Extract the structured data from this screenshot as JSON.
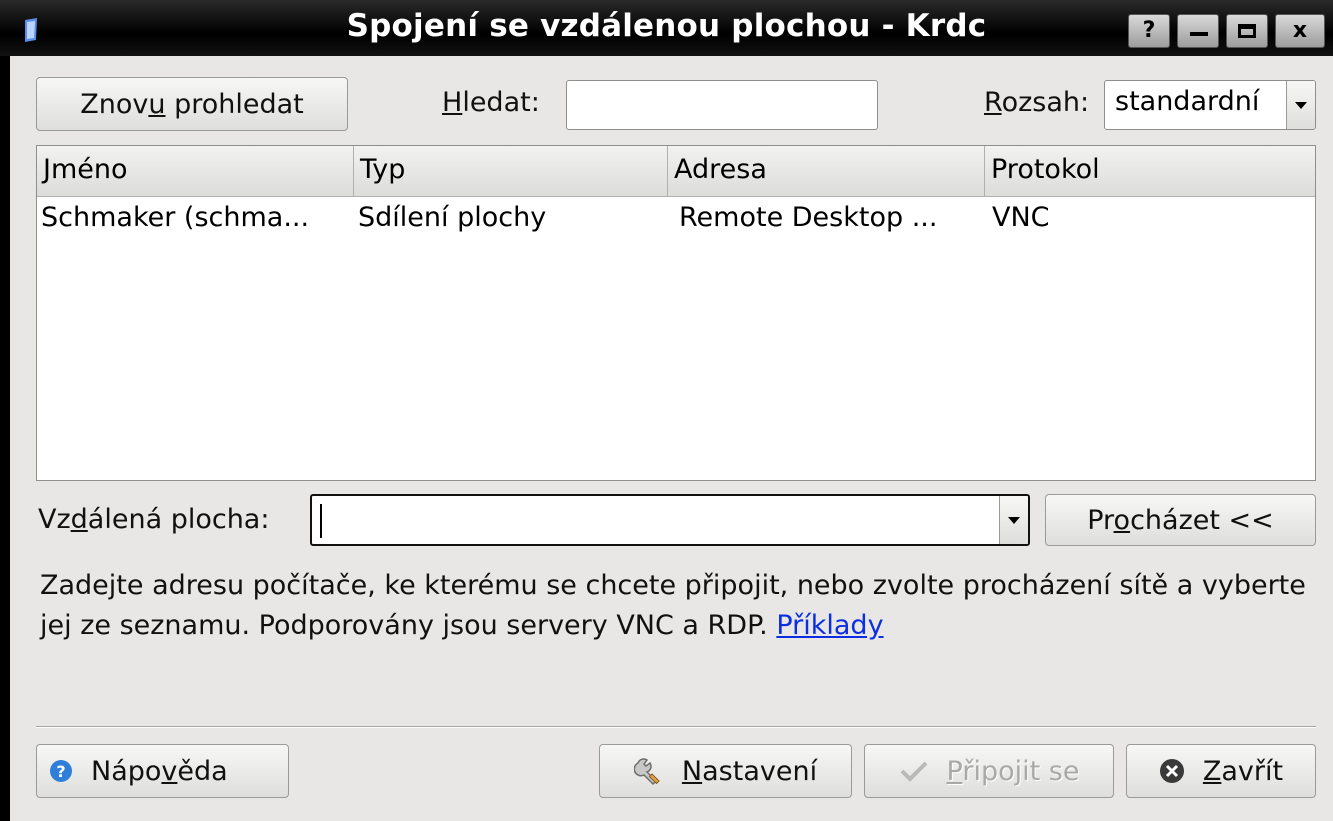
{
  "window": {
    "title": "Spojení se vzdálenou plochou - Krdc",
    "help_btn": "?",
    "close_btn": "x"
  },
  "toolbar": {
    "rescan_pre": "Znov",
    "rescan_u": "u",
    "rescan_post": " prohledat",
    "search_u": "H",
    "search_post": "ledat:",
    "search_value": "",
    "scope_u": "R",
    "scope_post": "ozsah:",
    "scope_value": "standardní"
  },
  "table": {
    "columns": [
      "Jméno",
      "Typ",
      "Adresa",
      "Protokol"
    ],
    "rows": [
      [
        "Schmaker (schma...",
        "Sdílení plochy",
        "Remote Desktop ...",
        "VNC"
      ]
    ]
  },
  "remote": {
    "label_pre": "Vz",
    "label_u": "d",
    "label_post": "álená plocha:",
    "value": "",
    "browse_pre": "Pr",
    "browse_u": "o",
    "browse_post": "cházet <<"
  },
  "description": {
    "text": "Zadejte adresu počítače, ke kterému se chcete připojit, nebo zvolte procházení sítě a vyberte jej ze seznamu. Podporovány jsou servery VNC a RDP. ",
    "link": "Příklady"
  },
  "buttons": {
    "help_pre": "Nápo",
    "help_u": "v",
    "help_post": "ěda",
    "settings_u": "N",
    "settings_post": "astavení",
    "connect_u": "P",
    "connect_post": "řipojit se",
    "close_u": "Z",
    "close_post": "avřít"
  },
  "colors": {
    "link": "#0b2fe0",
    "help_icon": "#2f7fd8"
  }
}
